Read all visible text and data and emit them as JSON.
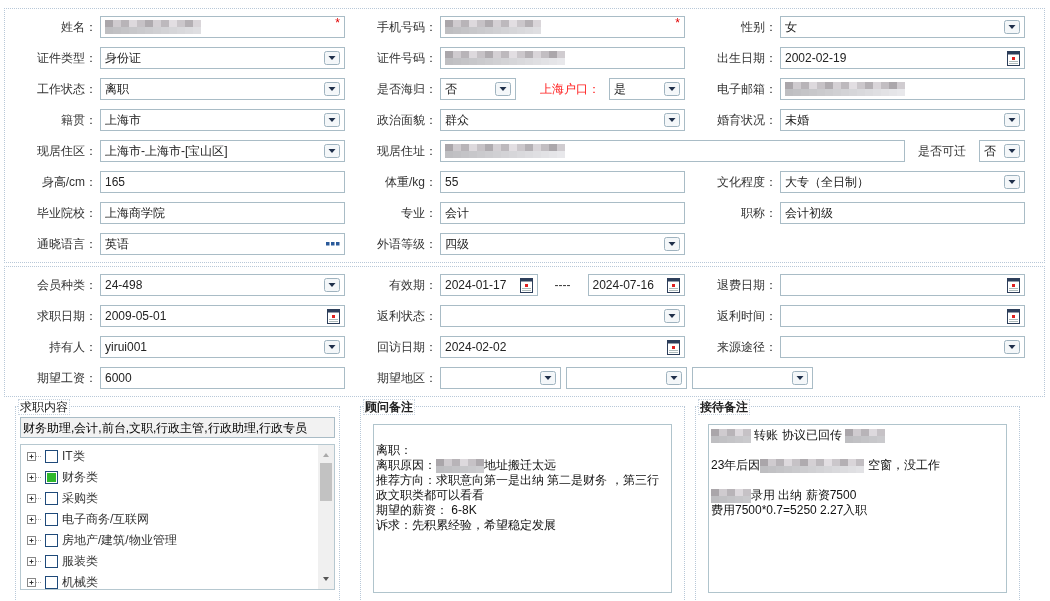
{
  "sections": [
    {
      "rows": [
        [
          {
            "label": "姓名：",
            "controls": [
              {
                "kind": "text",
                "redacted": true,
                "mark": "*"
              }
            ]
          },
          {
            "label": "手机号码：",
            "controls": [
              {
                "kind": "text",
                "redacted": true,
                "mark": "*"
              }
            ]
          },
          {
            "label": "性别：",
            "controls": [
              {
                "kind": "select",
                "value": "女"
              }
            ]
          }
        ],
        [
          {
            "label": "证件类型：",
            "controls": [
              {
                "kind": "select",
                "value": "身份证"
              }
            ]
          },
          {
            "label": "证件号码：",
            "controls": [
              {
                "kind": "text",
                "redacted": true
              }
            ]
          },
          {
            "label": "出生日期：",
            "controls": [
              {
                "kind": "date",
                "value": "2002-02-19"
              }
            ]
          }
        ],
        [
          {
            "label": "工作状态：",
            "controls": [
              {
                "kind": "select",
                "value": "离职"
              }
            ]
          },
          {
            "label": "是否海归：",
            "controls": [
              {
                "kind": "select",
                "value": "否"
              },
              {
                "kind": "label",
                "text": "上海户口：",
                "highlight": true
              },
              {
                "kind": "select",
                "value": "是"
              }
            ]
          },
          {
            "label": "电子邮箱：",
            "controls": [
              {
                "kind": "text",
                "redacted": true
              }
            ]
          }
        ],
        [
          {
            "label": "籍贯：",
            "controls": [
              {
                "kind": "select",
                "value": "上海市"
              }
            ]
          },
          {
            "label": "政治面貌：",
            "controls": [
              {
                "kind": "select",
                "value": "群众"
              }
            ]
          },
          {
            "label": "婚育状况：",
            "controls": [
              {
                "kind": "select",
                "value": "未婚"
              }
            ]
          }
        ],
        [
          {
            "label": "现居住区：",
            "controls": [
              {
                "kind": "select",
                "value": "上海市-上海市-[宝山区]"
              }
            ]
          },
          {
            "label": "现居住址：",
            "controls": [
              {
                "kind": "text",
                "redacted": true
              },
              {
                "kind": "label",
                "text": "是否可迁",
                "highlight": false
              },
              {
                "kind": "select",
                "value": "否"
              }
            ]
          }
        ],
        [
          {
            "label": "身高/cm：",
            "controls": [
              {
                "kind": "text",
                "value": "165"
              }
            ]
          },
          {
            "label": "体重/kg：",
            "controls": [
              {
                "kind": "text",
                "value": "55"
              }
            ]
          },
          {
            "label": "文化程度：",
            "controls": [
              {
                "kind": "select",
                "value": "大专（全日制）"
              }
            ]
          }
        ],
        [
          {
            "label": "毕业院校：",
            "controls": [
              {
                "kind": "text",
                "value": "上海商学院"
              }
            ]
          },
          {
            "label": "专业：",
            "controls": [
              {
                "kind": "text",
                "value": "会计"
              }
            ]
          },
          {
            "label": "职称：",
            "controls": [
              {
                "kind": "text",
                "value": "会计初级"
              }
            ]
          }
        ],
        [
          {
            "label": "通晓语言：",
            "controls": [
              {
                "kind": "lookup",
                "value": "英语"
              }
            ]
          },
          {
            "label": "外语等级：",
            "controls": [
              {
                "kind": "select",
                "value": "四级"
              }
            ]
          }
        ]
      ]
    },
    {
      "rows": [
        [
          {
            "label": "会员种类：",
            "controls": [
              {
                "kind": "select",
                "value": "24-498"
              }
            ]
          },
          {
            "label": "有效期：",
            "controls": [
              {
                "kind": "date",
                "value": "2024-01-17"
              },
              {
                "kind": "sep",
                "text": "----"
              },
              {
                "kind": "date",
                "value": "2024-07-16"
              }
            ]
          },
          {
            "label": "退费日期：",
            "controls": [
              {
                "kind": "date"
              }
            ]
          }
        ],
        [
          {
            "label": "求职日期：",
            "controls": [
              {
                "kind": "date",
                "value": "2009-05-01"
              }
            ]
          },
          {
            "label": "返利状态：",
            "controls": [
              {
                "kind": "select"
              }
            ]
          },
          {
            "label": "返利时间：",
            "controls": [
              {
                "kind": "date"
              }
            ]
          }
        ],
        [
          {
            "label": "持有人：",
            "controls": [
              {
                "kind": "select",
                "value": "yirui001"
              }
            ]
          },
          {
            "label": "回访日期：",
            "controls": [
              {
                "kind": "date",
                "value": "2024-02-02"
              }
            ]
          },
          {
            "label": "来源途径：",
            "controls": [
              {
                "kind": "select"
              }
            ]
          }
        ],
        [
          {
            "label": "期望工资：",
            "controls": [
              {
                "kind": "text",
                "value": "6000"
              }
            ]
          },
          {
            "label": "期望地区：",
            "controls": [
              {
                "kind": "select"
              },
              {
                "kind": "select"
              },
              {
                "kind": "select"
              }
            ]
          }
        ]
      ]
    }
  ],
  "job_content": {
    "legend": "求职内容",
    "summary": "财务助理,会计,前台,文职,行政主管,行政助理,行政专员",
    "tree": [
      {
        "label": "IT类",
        "checked": false,
        "expanded": false
      },
      {
        "label": "财务类",
        "checked": true,
        "expanded": false
      },
      {
        "label": "采购类",
        "checked": false,
        "expanded": false
      },
      {
        "label": "电子商务/互联网",
        "checked": false,
        "expanded": false
      },
      {
        "label": "房地产/建筑/物业管理",
        "checked": false,
        "expanded": false
      },
      {
        "label": "服装类",
        "checked": false,
        "expanded": false
      },
      {
        "label": "机械类",
        "checked": false,
        "expanded": false
      }
    ]
  },
  "notes": [
    {
      "legend": "顾问备注",
      "lines": [
        {
          "blank_before": true,
          "parts": [
            "离职："
          ]
        },
        {
          "blank_before": false,
          "parts": [
            "离职原因：",
            {
              "kind": "redacted"
            },
            "地址搬迁太远"
          ]
        },
        {
          "blank_before": false,
          "parts": [
            "推荐方向：求职意向第一是出纳 第二是财务 ，第三行政文职类都可以看看"
          ]
        },
        {
          "blank_before": false,
          "parts": [
            "期望的薪资： 6-8K"
          ]
        },
        {
          "blank_before": false,
          "parts": [
            "诉求：先积累经验，希望稳定发展"
          ]
        }
      ]
    },
    {
      "legend": "接待备注",
      "lines": [
        {
          "blank_before": false,
          "parts": [
            {
              "kind": "redacted"
            },
            " 转账 协议已回传 ",
            {
              "kind": "redacted"
            }
          ]
        },
        {
          "blank_before": true,
          "parts": [
            "23年后因",
            {
              "kind": "redacted"
            },
            " 空窗，没工作"
          ]
        },
        {
          "blank_before": true,
          "parts": [
            {
              "kind": "redacted"
            },
            "录用 出纳 薪资7500"
          ]
        },
        {
          "blank_before": false,
          "parts": [
            "费用7500*0.7=5250 2.27入职"
          ]
        }
      ]
    }
  ]
}
